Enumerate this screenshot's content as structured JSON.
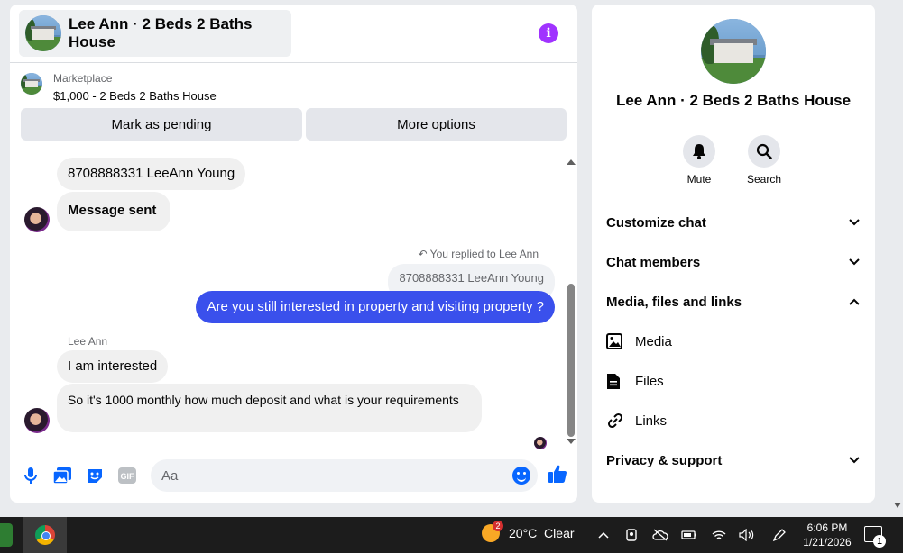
{
  "chat": {
    "title": "Lee Ann · 2 Beds 2 Baths House",
    "marketplace_label": "Marketplace",
    "listing": "$1,000 - 2 Beds 2 Baths House",
    "buttons": {
      "mark_pending": "Mark as pending",
      "more_options": "More options"
    },
    "messages": [
      {
        "text": "8708888331 LeeAnn Young",
        "from": "them"
      },
      {
        "text": "Message sent",
        "from": "them"
      },
      {
        "text": "You replied to Lee Ann",
        "kind": "reply-meta"
      },
      {
        "text": "8708888331 LeeAnn Young",
        "kind": "quote"
      },
      {
        "text": "Are you still interested in property and visiting property ?",
        "from": "me"
      },
      {
        "text": "Lee Ann",
        "kind": "sender"
      },
      {
        "text": "I am interested",
        "from": "them"
      },
      {
        "text": "So it's 1000 monthly how much deposit and what is your requirements",
        "from": "them"
      }
    ],
    "composer": {
      "placeholder": "Aa"
    }
  },
  "side": {
    "title": "Lee Ann · 2 Beds 2 Baths House",
    "actions": [
      {
        "label": "Mute",
        "icon": "bell-icon"
      },
      {
        "label": "Search",
        "icon": "search-icon"
      }
    ],
    "sections": {
      "customize": "Customize chat",
      "members": "Chat members",
      "media": "Media, files and links",
      "media_items": [
        "Media",
        "Files",
        "Links"
      ],
      "privacy": "Privacy & support"
    }
  },
  "taskbar": {
    "weather_badge": "2",
    "weather": "20°C  Clear",
    "time": "6:06 PM",
    "date": "1/21/2026",
    "notifications": "1"
  },
  "colors": {
    "accent": "#0866ff",
    "outgoing_bubble": "#3a50ec",
    "info": "#a033ff"
  }
}
